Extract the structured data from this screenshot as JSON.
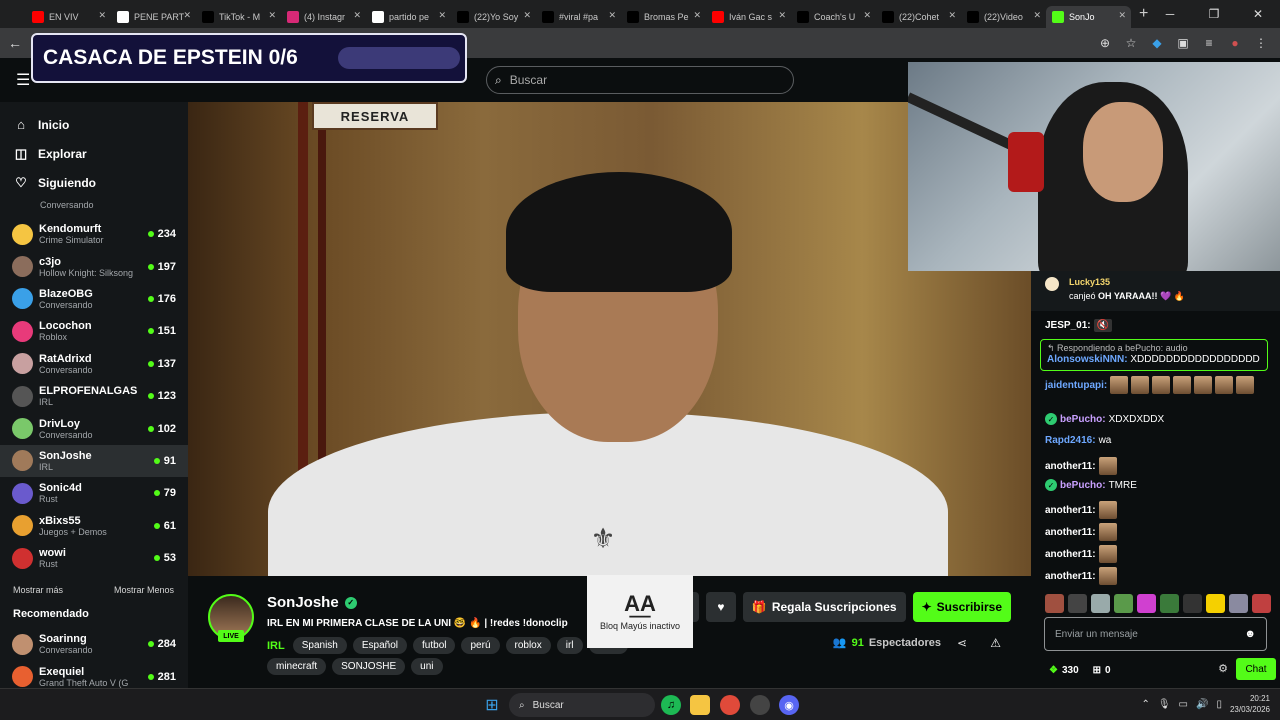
{
  "browser": {
    "tabs": [
      {
        "title": "EN VIV",
        "icon": "youtube-icon",
        "color": "#ff0000"
      },
      {
        "title": "PENE PART",
        "icon": "google-icon",
        "color": "#ffffff"
      },
      {
        "title": "TikTok - M",
        "icon": "tiktok-icon",
        "color": "#000000"
      },
      {
        "title": "(4) Instagr",
        "icon": "instagram-icon",
        "color": "#d62976"
      },
      {
        "title": "partido pe",
        "icon": "google-icon",
        "color": "#ffffff"
      },
      {
        "title": "(22)Yo Soy",
        "icon": "tiktok-icon",
        "color": "#000000"
      },
      {
        "title": "#viral #pa",
        "icon": "tiktok-icon",
        "color": "#000000"
      },
      {
        "title": "Bromas Pe",
        "icon": "tiktok-icon",
        "color": "#000000"
      },
      {
        "title": "Iván Gac s",
        "icon": "youtube-icon",
        "color": "#ff0000"
      },
      {
        "title": "Coach's U",
        "icon": "tiktok-icon",
        "color": "#000000"
      },
      {
        "title": "(22)Cohet",
        "icon": "tiktok-icon",
        "color": "#000000"
      },
      {
        "title": "(22)Video",
        "icon": "tiktok-icon",
        "color": "#000000"
      },
      {
        "title": "SonJo",
        "icon": "kick-icon",
        "color": "#53fc18",
        "active": true
      }
    ]
  },
  "header": {
    "search_placeholder": "Buscar"
  },
  "overlay": {
    "title": "CASACA DE EPSTEIN 0/6"
  },
  "osd": {
    "text": "Bloq Mayús inactivo"
  },
  "sidebar": {
    "nav": [
      {
        "label": "Inicio",
        "icon": "home-icon"
      },
      {
        "label": "Explorar",
        "icon": "compass-icon"
      },
      {
        "label": "Siguiendo",
        "icon": "heart-icon"
      }
    ],
    "partial_category": "Conversando",
    "channels": [
      {
        "name": "Kendomurft",
        "category": "Crime Simulator",
        "viewers": "234",
        "color": "#f5c542"
      },
      {
        "name": "c3jo",
        "category": "Hollow Knight: Silksong",
        "viewers": "197",
        "color": "#8b6d5c"
      },
      {
        "name": "BlazeOBG",
        "category": "Conversando",
        "viewers": "176",
        "color": "#3aa0e8"
      },
      {
        "name": "Locochon",
        "category": "Roblox",
        "viewers": "151",
        "color": "#e83a7a"
      },
      {
        "name": "RatAdrixd",
        "category": "Conversando",
        "viewers": "137",
        "color": "#c8a0a0"
      },
      {
        "name": "ELPROFENALGAS",
        "category": "IRL",
        "viewers": "123",
        "color": "#555555"
      },
      {
        "name": "DrivLoy",
        "category": "Conversando",
        "viewers": "102",
        "color": "#7ac86a"
      },
      {
        "name": "SonJoshe",
        "category": "IRL",
        "viewers": "91",
        "color": "#a07a5a",
        "active": true
      },
      {
        "name": "Sonic4d",
        "category": "Rust",
        "viewers": "79",
        "color": "#6a5acd"
      },
      {
        "name": "xBixs55",
        "category": "Juegos + Demos",
        "viewers": "61",
        "color": "#e8a030"
      },
      {
        "name": "wowi",
        "category": "Rust",
        "viewers": "53",
        "color": "#d03030"
      }
    ],
    "show_more": "Mostrar más",
    "show_less": "Mostrar Menos",
    "recommended_title": "Recomendado",
    "recommended": [
      {
        "name": "Soarinng",
        "category": "Conversando",
        "viewers": "284",
        "color": "#c09070"
      },
      {
        "name": "Exequiel",
        "category": "Grand Theft Auto V (G",
        "viewers": "281",
        "color": "#e86030"
      }
    ]
  },
  "stream": {
    "reserva_sign": "RESERVA",
    "streamer": "SonJoshe",
    "live_label": "LIVE",
    "title": "IRL EN MI PRIMERA CLASE DE LA UNI 🤓 🔥 | !redes !donoclip",
    "category": "IRL",
    "tags_row1": [
      "Spanish",
      "Español",
      "futbol",
      "perú",
      "roblox",
      "irl",
      "haxb"
    ],
    "tags_row2": [
      "minecraft",
      "SONJOSHE",
      "uni"
    ],
    "gift_label": "Regala Suscripciones",
    "subscribe_label": "Suscribirse",
    "viewers": "91",
    "viewers_label": "Espectadores"
  },
  "chat": {
    "pinned_user": "Lucky135",
    "pinned_text_prefix": "canjeó",
    "pinned_text_bold": "OH YARAAA!!",
    "messages": [
      {
        "user": "JESP_01:",
        "color": "#ffffff",
        "text": "",
        "emotes": 0,
        "extra": "mute-icon"
      },
      {
        "user": "jaidentupapi:",
        "color": "#6ea8ff",
        "text": "",
        "emotes": 7
      },
      {
        "user": "bePucho:",
        "color": "#c9a0ff",
        "text": "XDXDXDDX",
        "emotes": 0,
        "badge": true
      },
      {
        "user": "Rapd2416:",
        "color": "#6ea8ff",
        "text": "wa",
        "emotes": 0
      },
      {
        "user": "another11:",
        "color": "#ffffff",
        "text": "",
        "emotes": 1
      },
      {
        "user": "bePucho:",
        "color": "#c9a0ff",
        "text": "TMRE",
        "emotes": 0,
        "badge": true
      },
      {
        "user": "another11:",
        "color": "#ffffff",
        "text": "",
        "emotes": 1
      },
      {
        "user": "another11:",
        "color": "#ffffff",
        "text": "",
        "emotes": 1
      },
      {
        "user": "another11:",
        "color": "#ffffff",
        "text": "",
        "emotes": 1
      },
      {
        "user": "another11:",
        "color": "#ffffff",
        "text": "",
        "emotes": 1
      }
    ],
    "reply_hint": "Respondiendo a bePucho: audio",
    "reply_user": "AlonsowskiNNN:",
    "reply_text": "XDDDDDDDDDDDDDDDDD",
    "input_placeholder": "Enviar un mensaje",
    "points": "330",
    "gifts": "0",
    "send_label": "Chat"
  },
  "taskbar": {
    "search_placeholder": "Buscar",
    "time": "20:21",
    "date": "23/03/2026"
  }
}
